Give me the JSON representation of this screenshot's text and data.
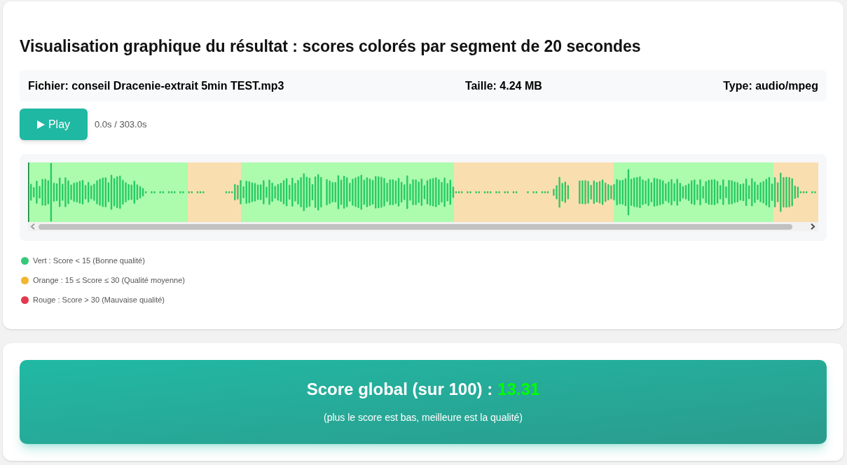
{
  "title": "Visualisation graphique du résultat : scores colorés par segment de 20 secondes",
  "file_info": {
    "name": "Fichier: conseil Dracenie-extrait 5min TEST.mp3",
    "size": "Taille: 4.24 MB",
    "type": "Type: audio/mpeg"
  },
  "player": {
    "button": {
      "label": "Play"
    },
    "time": "0.0s / 303.0s"
  },
  "waveform": {
    "segments": [
      {
        "color": "#adfbad"
      },
      {
        "color": "#adfbad"
      },
      {
        "color": "#adfbad"
      },
      {
        "color": "#f9dfaf"
      },
      {
        "color": "#adfbad"
      },
      {
        "color": "#adfbad"
      },
      {
        "color": "#adfbad"
      },
      {
        "color": "#adfbad"
      },
      {
        "color": "#f9dfaf"
      },
      {
        "color": "#f9dfaf"
      },
      {
        "color": "#f9dfaf"
      },
      {
        "color": "#adfbad"
      },
      {
        "color": "#adfbad"
      },
      {
        "color": "#adfbad"
      },
      {
        "color": "#f9dfaf"
      }
    ]
  },
  "legend": [
    {
      "label": "Vert : Score < 15 (Bonne qualité)",
      "color": "#37c978"
    },
    {
      "label": "Orange : 15 ≤ Score ≤ 30 (Qualité moyenne)",
      "color": "#f2b630"
    },
    {
      "label": "Rouge : Score > 30 (Mauvaise qualité)",
      "color": "#e33a4f"
    }
  ],
  "score": {
    "label": "Score global (sur 100) :",
    "value": "13.31",
    "color": "#00ff00",
    "note": "(plus le score est bas, meilleure est la qualité)"
  }
}
